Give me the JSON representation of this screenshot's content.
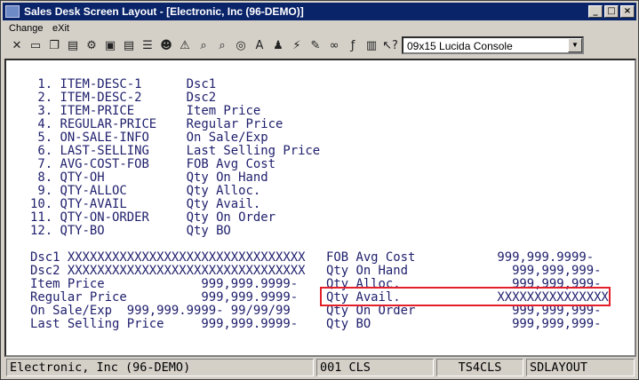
{
  "window": {
    "title": "Sales Desk Screen Layout - [Electronic, Inc (96-DEMO)]"
  },
  "titlebar_buttons": [
    "_",
    "□",
    "×"
  ],
  "menu": [
    "Change",
    "eXit"
  ],
  "toolbar_icons": [
    "close-x-icon",
    "new-page-icon",
    "copy-icon",
    "paste-icon",
    "settings-icon",
    "window-icon",
    "page-icon",
    "list-icon",
    "user-icon",
    "warning-icon",
    "find-icon",
    "search-icon",
    "globe-icon",
    "font-icon",
    "person-icon",
    "lightning-icon",
    "edit-icon",
    "link-icon",
    "function-icon",
    "list-view-icon",
    "help-pointer-icon"
  ],
  "toolbar_glyphs": [
    "✕",
    "▭",
    "❐",
    "▤",
    "⚙",
    "▣",
    "▤",
    "☰",
    "☻",
    "⚠",
    "⌕",
    "⌕",
    "◎",
    "A",
    "♟",
    "⚡",
    "✎",
    "∞",
    "ƒ",
    "▥",
    "↖?"
  ],
  "font_select": {
    "value": "09x15 Lucida Console"
  },
  "field_list": [
    " 1. ITEM-DESC-1      Dsc1",
    " 2. ITEM-DESC-2      Dsc2",
    " 3. ITEM-PRICE       Item Price",
    " 4. REGULAR-PRICE    Regular Price",
    " 5. ON-SALE-INFO     On Sale/Exp",
    " 6. LAST-SELLING     Last Selling Price",
    " 7. AVG-COST-FOB     FOB Avg Cost",
    " 8. QTY-OH           Qty On Hand",
    " 9. QTY-ALLOC        Qty Alloc.",
    "10. QTY-AVAIL        Qty Avail.",
    "11. QTY-ON-ORDER     Qty On Order",
    "12. QTY-BO           Qty BO"
  ],
  "layout_left": [
    "Dsc1 XXXXXXXXXXXXXXXXXXXXXXXXXXXXXXXX",
    "Dsc2 XXXXXXXXXXXXXXXXXXXXXXXXXXXXXXXX",
    "Item Price             999,999.9999-",
    "Regular Price          999,999.9999-",
    "On Sale/Exp  999,999.9999- 99/99/99",
    "Last Selling Price     999,999.9999-"
  ],
  "layout_right": [
    "FOB Avg Cost           999,999.9999-",
    "Qty On Hand              999,999,999-",
    "Qty Alloc.               999,999,999-",
    "Qty Avail.             XXXXXXXXXXXXXXX",
    "Qty On Order             999,999,999-",
    "Qty BO                   999,999,999-"
  ],
  "status": {
    "company": "Electronic, Inc (96-DEMO)",
    "code": "001 CLS",
    "ts": "TS4CLS",
    "program": "SDLAYOUT"
  }
}
